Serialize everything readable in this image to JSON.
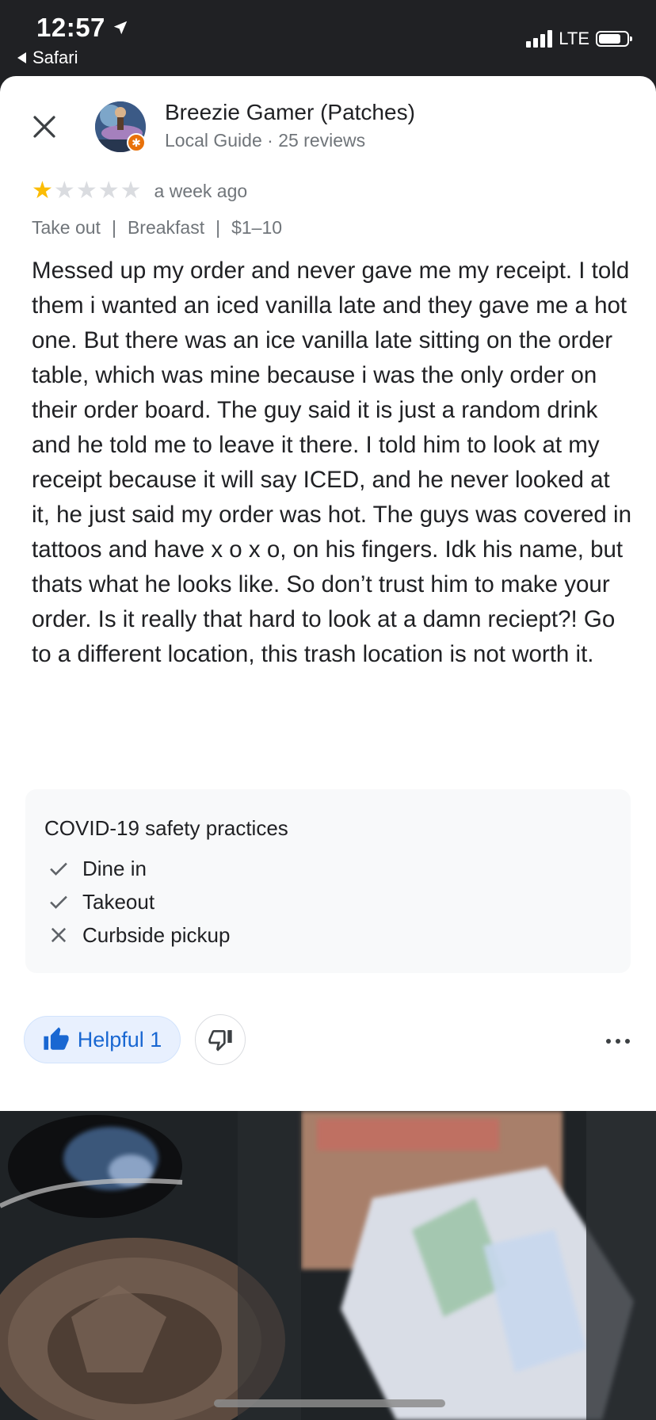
{
  "status_bar": {
    "time": "12:57",
    "back_app": "Safari",
    "network": "LTE",
    "signal_bars": 4,
    "battery_level": 0.8
  },
  "review": {
    "author_name": "Breezie Gamer (Patches)",
    "author_meta": "Local Guide · 25 reviews",
    "rating": 1,
    "rating_max": 5,
    "time_ago": "a week ago",
    "tags": [
      "Take out",
      "Breakfast",
      "$1–10"
    ],
    "text": "Messed up my order and never gave me my receipt. I told them i wanted an iced vanilla late and they gave me a hot one. But there was an ice vanilla late sitting on the order table, which was mine because i was the only order on their order board. The guy said it is just a random drink and he told me to leave it there. I told him to look at my receipt because it will say ICED, and he never looked at it, he just said my order was hot. The guys was covered in tattoos and have x o x o, on his fingers. Idk his name, but thats what he looks like. So don’t trust him to make your order. Is it really that hard to look at a damn reciept?! Go to a different location, this trash location is not worth it."
  },
  "covid": {
    "title": "COVID-19 safety practices",
    "items": [
      {
        "label": "Dine in",
        "available": true
      },
      {
        "label": "Takeout",
        "available": true
      },
      {
        "label": "Curbside pickup",
        "available": false
      }
    ]
  },
  "actions": {
    "helpful_label": "Helpful 1"
  },
  "colors": {
    "accent_blue": "#1967d2",
    "star_yellow": "#fbbc04",
    "guide_badge_orange": "#e8710a"
  },
  "icons": {
    "close": "close-icon",
    "thumbs_up": "thumbs-up-icon",
    "thumbs_down": "thumbs-down-icon",
    "more": "more-horizontal-icon",
    "check": "check-icon",
    "cross": "x-icon"
  }
}
